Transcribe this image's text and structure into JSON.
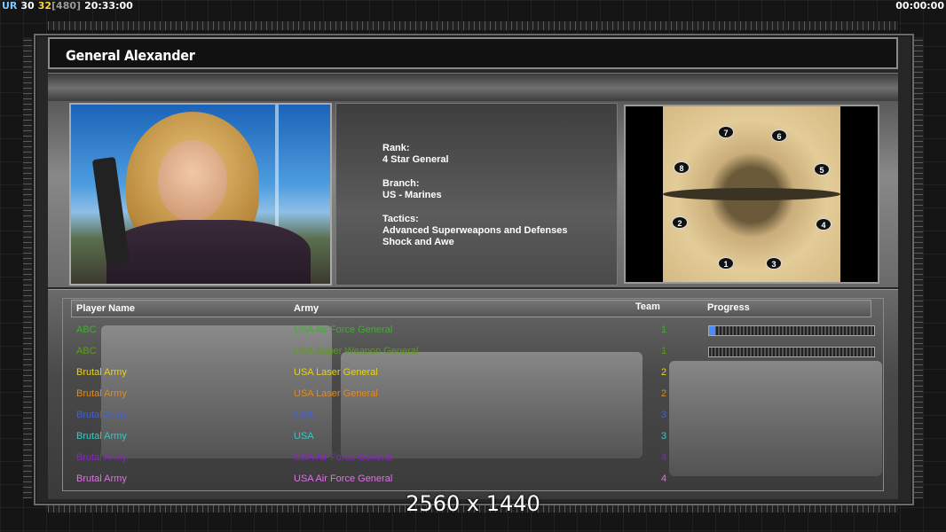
{
  "hud": {
    "ur": "UR",
    "fps1": "30",
    "fps2": "32",
    "fps3": "[480]",
    "clock": "20:33:00",
    "timer": "00:00:00"
  },
  "title": "General Alexander",
  "info": {
    "rank_label": "Rank:",
    "rank_value": "4 Star General",
    "branch_label": "Branch:",
    "branch_value": "US - Marines",
    "tactics_label": "Tactics:",
    "tactics_line1": "Advanced Superweapons and Defenses",
    "tactics_line2": "Shock and Awe"
  },
  "map": {
    "spots": [
      "1",
      "2",
      "3",
      "4",
      "5",
      "6",
      "7",
      "8"
    ]
  },
  "table": {
    "headers": {
      "player": "Player Name",
      "army": "Army",
      "team": "Team",
      "progress": "Progress"
    },
    "rows": [
      {
        "player": "ABC",
        "army": "USA Air Force General",
        "team": "1",
        "color": "#3fae2e",
        "progress": 0.04
      },
      {
        "player": "ABC",
        "army": "USA Super Weapon General",
        "team": "1",
        "color": "#5d9a1f",
        "progress": 0.0
      },
      {
        "player": "Brutal Army",
        "army": "USA Laser General",
        "team": "2",
        "color": "#e6d21a"
      },
      {
        "player": "Brutal Army",
        "army": "USA Laser General",
        "team": "2",
        "color": "#e38a1c"
      },
      {
        "player": "Brutal Army",
        "army": "USA",
        "team": "3",
        "color": "#3f5fe0"
      },
      {
        "player": "Brutal Army",
        "army": "USA",
        "team": "3",
        "color": "#35c9c4"
      },
      {
        "player": "Brutal Army",
        "army": "USA Air Force General",
        "team": "4",
        "color": "#8b22c9"
      },
      {
        "player": "Brutal Army",
        "army": "USA Air Force General",
        "team": "4",
        "color": "#e070e8"
      }
    ]
  },
  "watermark": "2560 x 1440"
}
